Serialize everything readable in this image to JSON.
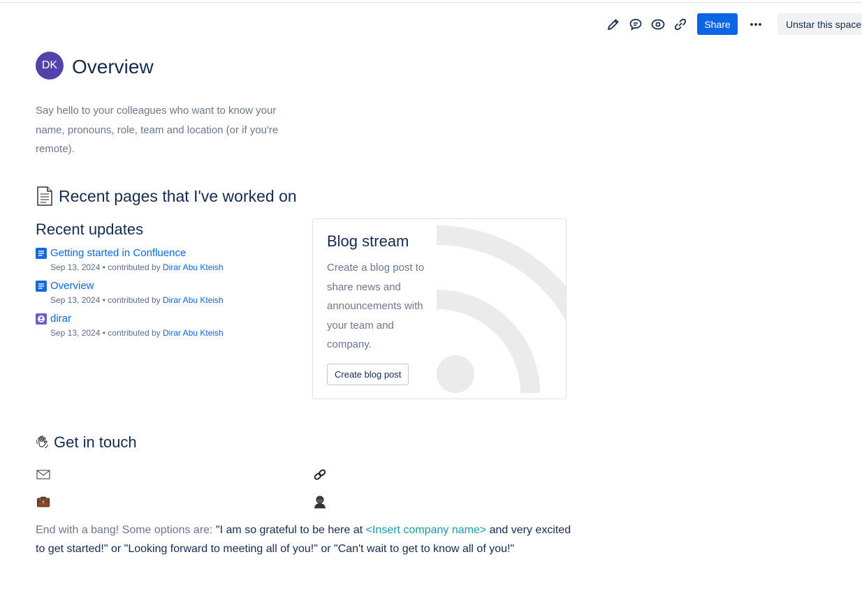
{
  "toolbar": {
    "share_label": "Share",
    "unstar_label": "Unstar this space",
    "icons": [
      "edit-icon",
      "comment-icon",
      "watch-icon",
      "copy-link-icon",
      "more-icon"
    ]
  },
  "page": {
    "avatar_initials": "DK",
    "avatar_color": "#5243aa",
    "title": "Overview",
    "intro": "Say hello to your colleagues who want to know your name, pronouns, role, team and location (or if you're remote)."
  },
  "recent": {
    "heading": "Recent pages that I've worked on",
    "updates_heading": "Recent updates",
    "items": [
      {
        "title": "Getting started in Confluence",
        "date": "Sep 13, 2024",
        "contributed": "• contributed by",
        "author": "Dirar Abu Kteish",
        "icon": "page-icon"
      },
      {
        "title": "Overview",
        "date": "Sep 13, 2024",
        "contributed": "• contributed by",
        "author": "Dirar Abu Kteish",
        "icon": "page-icon"
      },
      {
        "title": "dirar",
        "date": "Sep 13, 2024",
        "contributed": "• contributed by",
        "author": "Dirar Abu Kteish",
        "icon": "profile-icon"
      }
    ]
  },
  "blog": {
    "title": "Blog stream",
    "description": "Create a blog post to share news and announcements with your team and company.",
    "button_label": "Create blog post"
  },
  "touch": {
    "heading": "Get in touch",
    "icons": [
      "envelope-icon",
      "link-icon",
      "briefcase-icon",
      "person-icon"
    ]
  },
  "closing": {
    "lead": "End with a bang! Some options are:",
    "part1": " \"I am so grateful to be here at ",
    "placeholder": "<Insert company name>",
    "part2": " and very excited to get started!\" or \"Looking forward to meeting all of you!\" or \"Can't wait to get to know all of you!\""
  },
  "colors": {
    "accent": "#0c66e4",
    "text": "#172b4d",
    "muted": "#6b778c",
    "placeholder": "#1d9aaa"
  }
}
